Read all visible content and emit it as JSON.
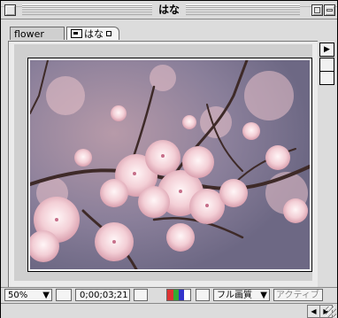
{
  "window": {
    "title": "はな"
  },
  "tabs": [
    {
      "label": "flower"
    },
    {
      "label": "はな"
    }
  ],
  "status": {
    "zoom": "50%",
    "timecode": "0;00;03;21",
    "quality": "フル画質",
    "active": "アクティブ"
  },
  "colors": {
    "panel": "#ebebeb",
    "frame": "#cfcfcf"
  }
}
